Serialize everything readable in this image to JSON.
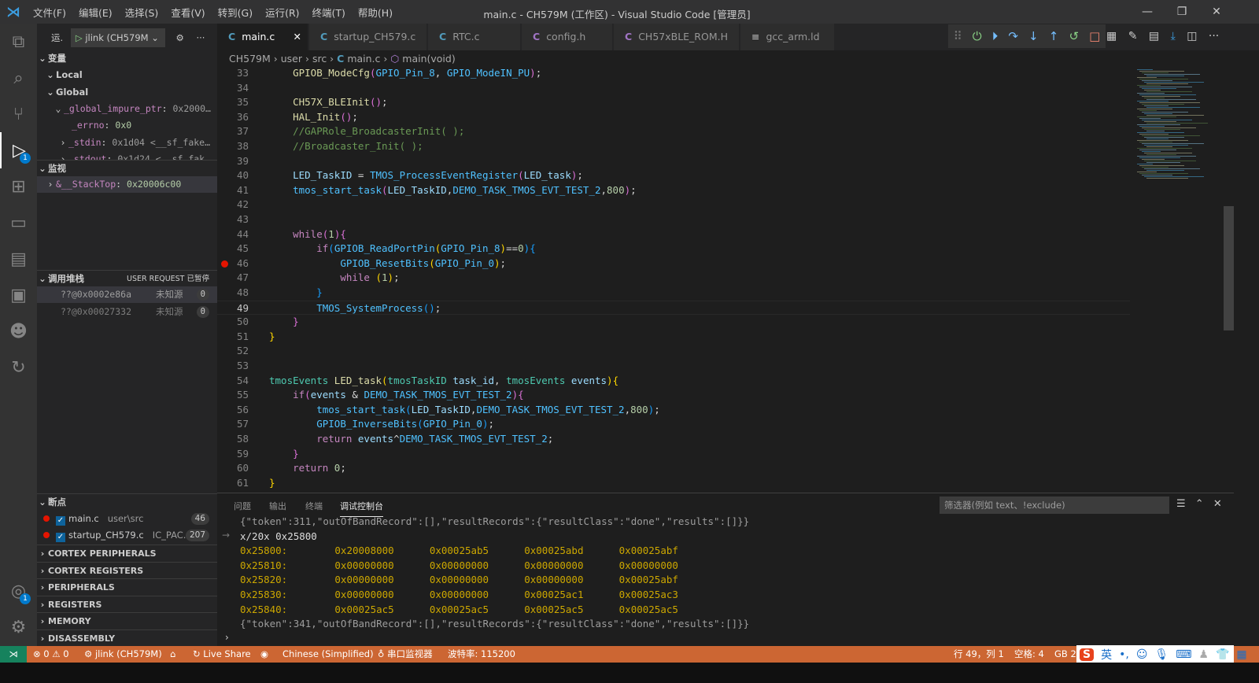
{
  "titlebar": {
    "menus": [
      "文件(F)",
      "编辑(E)",
      "选择(S)",
      "查看(V)",
      "转到(G)",
      "运行(R)",
      "终端(T)",
      "帮助(H)"
    ],
    "title": "main.c - CH579M (工作区) - Visual Studio Code [管理员]"
  },
  "activity": {
    "debug_badge": "1",
    "accounts_badge": "1"
  },
  "sidebar": {
    "run_label": "运.",
    "config": "jlink (CH579M",
    "variables": {
      "title": "变量",
      "local": "Local",
      "global": "Global",
      "items": [
        {
          "name": "_global_impure_ptr",
          "value": "0x2000…"
        },
        {
          "name": "_errno",
          "value": "0x0"
        },
        {
          "name": "_stdin",
          "value": "0x1d04 <__sf_fake…"
        },
        {
          "name": "_stdout",
          "value": "0x1d24 <__sf_fak…"
        }
      ]
    },
    "watch": {
      "title": "监视",
      "items": [
        {
          "name": "&__StackTop",
          "value": "0x20006c00"
        }
      ]
    },
    "callstack": {
      "title": "调用堆栈",
      "status": "USER REQUEST 已暂停",
      "frames": [
        {
          "name": "??@0x0002e86a",
          "source": "未知源",
          "line": "0"
        },
        {
          "name": "??@0x00027332",
          "source": "未知源",
          "line": "0"
        }
      ]
    },
    "breakpoints": {
      "title": "断点",
      "items": [
        {
          "file": "main.c",
          "path": "user\\src",
          "line": "46"
        },
        {
          "file": "startup_CH579.c",
          "path": "IC_PAC...",
          "line": "207"
        }
      ]
    },
    "sections": [
      "CORTEX PERIPHERALS",
      "CORTEX REGISTERS",
      "PERIPHERALS",
      "REGISTERS",
      "MEMORY",
      "DISASSEMBLY"
    ]
  },
  "tabs": [
    {
      "label": "main.c",
      "active": true
    },
    {
      "label": "startup_CH579.c"
    },
    {
      "label": "RTC.c"
    },
    {
      "label": "config.h"
    },
    {
      "label": "CH57xBLE_ROM.H"
    },
    {
      "label": "gcc_arm.ld"
    }
  ],
  "breadcrumb": [
    "CH579M",
    "user",
    "src",
    "main.c",
    "main(void)"
  ],
  "editor": {
    "current_line": 49,
    "breakpoint_line": 46,
    "lines": [
      {
        "n": 33,
        "t": [
          [
            "    ",
            ""
          ],
          [
            "GPIOB_ModeCfg",
            "fn"
          ],
          [
            "(",
            "br2"
          ],
          [
            "GPIO_Pin_8",
            "mac"
          ],
          [
            ", ",
            "pl"
          ],
          [
            "GPIO_ModeIN_PU",
            "mac"
          ],
          [
            ")",
            "br2"
          ],
          [
            ";",
            "pl"
          ]
        ]
      },
      {
        "n": 34,
        "t": []
      },
      {
        "n": 35,
        "t": [
          [
            "    ",
            ""
          ],
          [
            "CH57X_BLEInit",
            "fn"
          ],
          [
            "()",
            "br2"
          ],
          [
            ";",
            "pl"
          ]
        ]
      },
      {
        "n": 36,
        "t": [
          [
            "    ",
            ""
          ],
          [
            "HAL_Init",
            "fn"
          ],
          [
            "()",
            "br2"
          ],
          [
            ";",
            "pl"
          ]
        ]
      },
      {
        "n": 37,
        "t": [
          [
            "    ",
            ""
          ],
          [
            "//GAPRole_BroadcasterInit( );",
            "cm"
          ]
        ]
      },
      {
        "n": 38,
        "t": [
          [
            "    ",
            ""
          ],
          [
            "//Broadcaster_Init( );",
            "cm"
          ]
        ]
      },
      {
        "n": 39,
        "t": []
      },
      {
        "n": 40,
        "t": [
          [
            "    ",
            ""
          ],
          [
            "LED_TaskID",
            "var"
          ],
          [
            " = ",
            "pl"
          ],
          [
            "TMOS_ProcessEventRegister",
            "mac"
          ],
          [
            "(",
            "br2"
          ],
          [
            "LED_task",
            "var"
          ],
          [
            ")",
            "br2"
          ],
          [
            ";",
            "pl"
          ]
        ]
      },
      {
        "n": 41,
        "t": [
          [
            "    ",
            ""
          ],
          [
            "tmos_start_task",
            "mac"
          ],
          [
            "(",
            "br2"
          ],
          [
            "LED_TaskID",
            "var"
          ],
          [
            ",",
            "pl"
          ],
          [
            "DEMO_TASK_TMOS_EVT_TEST_2",
            "mac"
          ],
          [
            ",",
            "pl"
          ],
          [
            "800",
            "num"
          ],
          [
            ")",
            "br2"
          ],
          [
            ";",
            "pl"
          ]
        ]
      },
      {
        "n": 42,
        "t": []
      },
      {
        "n": 43,
        "t": []
      },
      {
        "n": 44,
        "t": [
          [
            "    ",
            ""
          ],
          [
            "while",
            "kw"
          ],
          [
            "(",
            "br2"
          ],
          [
            "1",
            "num"
          ],
          [
            ")",
            "br2"
          ],
          [
            "{",
            "br2"
          ]
        ]
      },
      {
        "n": 45,
        "t": [
          [
            "        ",
            ""
          ],
          [
            "if",
            "kw"
          ],
          [
            "(",
            "br3"
          ],
          [
            "GPIOB_ReadPortPin",
            "mac"
          ],
          [
            "(",
            "br"
          ],
          [
            "GPIO_Pin_8",
            "mac"
          ],
          [
            ")",
            "br"
          ],
          [
            "==",
            "pl"
          ],
          [
            "0",
            "num"
          ],
          [
            "){",
            "br3"
          ]
        ]
      },
      {
        "n": 46,
        "t": [
          [
            "            ",
            ""
          ],
          [
            "GPIOB_ResetBits",
            "mac"
          ],
          [
            "(",
            "br"
          ],
          [
            "GPIO_Pin_0",
            "mac"
          ],
          [
            ")",
            "br"
          ],
          [
            ";",
            "pl"
          ]
        ]
      },
      {
        "n": 47,
        "t": [
          [
            "            ",
            ""
          ],
          [
            "while",
            "kw"
          ],
          [
            " ",
            "pl"
          ],
          [
            "(",
            "br"
          ],
          [
            "1",
            "num"
          ],
          [
            ")",
            "br"
          ],
          [
            ";",
            "pl"
          ]
        ]
      },
      {
        "n": 48,
        "t": [
          [
            "        ",
            ""
          ],
          [
            "}",
            "br3"
          ]
        ]
      },
      {
        "n": 49,
        "t": [
          [
            "        ",
            ""
          ],
          [
            "TMOS_SystemProcess",
            "mac"
          ],
          [
            "()",
            "br3"
          ],
          [
            ";",
            "pl"
          ]
        ]
      },
      {
        "n": 50,
        "t": [
          [
            "    ",
            ""
          ],
          [
            "}",
            "br2"
          ]
        ]
      },
      {
        "n": 51,
        "t": [
          [
            "}",
            "br"
          ]
        ]
      },
      {
        "n": 52,
        "t": []
      },
      {
        "n": 53,
        "t": []
      },
      {
        "n": 54,
        "t": [
          [
            "tmosEvents",
            "ty"
          ],
          [
            " ",
            "pl"
          ],
          [
            "LED_task",
            "fn"
          ],
          [
            "(",
            "br"
          ],
          [
            "tmosTaskID",
            "ty"
          ],
          [
            " ",
            "pl"
          ],
          [
            "task_id",
            "var"
          ],
          [
            ", ",
            "pl"
          ],
          [
            "tmosEvents",
            "ty"
          ],
          [
            " ",
            "pl"
          ],
          [
            "events",
            "var"
          ],
          [
            ")",
            "br"
          ],
          [
            "{",
            "br"
          ]
        ]
      },
      {
        "n": 55,
        "t": [
          [
            "    ",
            ""
          ],
          [
            "if",
            "kw"
          ],
          [
            "(",
            "br2"
          ],
          [
            "events",
            "var"
          ],
          [
            " & ",
            "pl"
          ],
          [
            "DEMO_TASK_TMOS_EVT_TEST_2",
            "mac"
          ],
          [
            ")",
            "br2"
          ],
          [
            "{",
            "br2"
          ]
        ]
      },
      {
        "n": 56,
        "t": [
          [
            "        ",
            ""
          ],
          [
            "tmos_start_task",
            "mac"
          ],
          [
            "(",
            "br3"
          ],
          [
            "LED_TaskID",
            "var"
          ],
          [
            ",",
            "pl"
          ],
          [
            "DEMO_TASK_TMOS_EVT_TEST_2",
            "mac"
          ],
          [
            ",",
            "pl"
          ],
          [
            "800",
            "num"
          ],
          [
            ")",
            "br3"
          ],
          [
            ";",
            "pl"
          ]
        ]
      },
      {
        "n": 57,
        "t": [
          [
            "        ",
            ""
          ],
          [
            "GPIOB_InverseBits",
            "mac"
          ],
          [
            "(",
            "br3"
          ],
          [
            "GPIO_Pin_0",
            "mac"
          ],
          [
            ")",
            "br3"
          ],
          [
            ";",
            "pl"
          ]
        ]
      },
      {
        "n": 58,
        "t": [
          [
            "        ",
            ""
          ],
          [
            "return",
            "kw"
          ],
          [
            " ",
            "pl"
          ],
          [
            "events",
            "var"
          ],
          [
            "^",
            "pl"
          ],
          [
            "DEMO_TASK_TMOS_EVT_TEST_2",
            "mac"
          ],
          [
            ";",
            "pl"
          ]
        ]
      },
      {
        "n": 59,
        "t": [
          [
            "    ",
            ""
          ],
          [
            "}",
            "br2"
          ]
        ]
      },
      {
        "n": 60,
        "t": [
          [
            "    ",
            ""
          ],
          [
            "return",
            "kw"
          ],
          [
            " ",
            "pl"
          ],
          [
            "0",
            "num"
          ],
          [
            ";",
            "pl"
          ]
        ]
      },
      {
        "n": 61,
        "t": [
          [
            "}",
            "br"
          ]
        ]
      }
    ]
  },
  "panel": {
    "tabs": [
      "问题",
      "输出",
      "终端",
      "调试控制台"
    ],
    "active_tab": 3,
    "filter_placeholder": "筛选器(例如 text、!exclude)",
    "lines": [
      {
        "text": "{\"token\":311,\"outOfBandRecord\":[],\"resultRecords\":{\"resultClass\":\"done\",\"results\":[]}}",
        "style": "gray"
      },
      {
        "text": "x/20x 0x25800",
        "style": "white",
        "input": true
      },
      {
        "text": "0x25800:        0x20008000      0x00025ab5      0x00025abd      0x00025abf",
        "style": "yel"
      },
      {
        "text": "0x25810:        0x00000000      0x00000000      0x00000000      0x00000000",
        "style": "yel"
      },
      {
        "text": "0x25820:        0x00000000      0x00000000      0x00000000      0x00025abf",
        "style": "yel"
      },
      {
        "text": "0x25830:        0x00000000      0x00000000      0x00025ac1      0x00025ac3",
        "style": "yel"
      },
      {
        "text": "0x25840:        0x00025ac5      0x00025ac5      0x00025ac5      0x00025ac5",
        "style": "yel"
      },
      {
        "text": "{\"token\":341,\"outOfBandRecord\":[],\"resultRecords\":{\"resultClass\":\"done\",\"results\":[]}}",
        "style": "gray"
      }
    ]
  },
  "status": {
    "errors": "0",
    "warnings": "0",
    "debug_config": "jlink (CH579M)",
    "live_share": "Live Share",
    "language": "Chinese (Simplified)",
    "serial": "串口监视器",
    "baud": "波特率: 115200",
    "position": "行 49，列 1",
    "spaces": "空格: 4",
    "encoding": "GB 2"
  },
  "ime": {
    "logo": "S",
    "mode": "英",
    "punct": "•,"
  },
  "colors": {
    "status_bar": "#cc6633",
    "remote": "#16825d",
    "accent": "#007acc"
  }
}
